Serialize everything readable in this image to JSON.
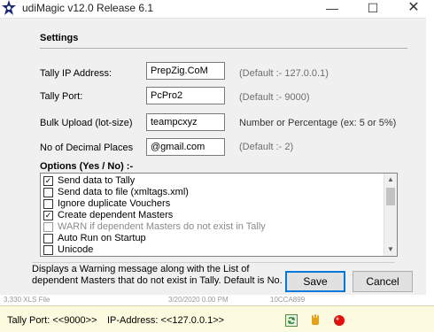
{
  "window": {
    "title": "udiMagic v12.0 Release 6.1",
    "minimize_glyph": "—",
    "maximize_glyph": "☐",
    "close_glyph": "✕"
  },
  "settings": {
    "title": "Settings",
    "fields": [
      {
        "label": "Tally IP Address:",
        "value": "PrepZig.CoM",
        "hint": "(Default :-  127.0.0.1)"
      },
      {
        "label": "Tally Port:",
        "value": "PcPro2",
        "hint": "(Default :-  9000)"
      },
      {
        "label": "Bulk Upload (lot-size)",
        "value": "teampcxyz",
        "hint": "Number or Percentage (ex: 5 or  5%)"
      },
      {
        "label": "No of Decimal Places",
        "value": "@gmail.com",
        "hint": "(Default :-  2)"
      }
    ]
  },
  "options": {
    "title": "Options (Yes / No) :-",
    "items": [
      {
        "label": "Send data to Tally",
        "checked": true,
        "disabled": false
      },
      {
        "label": "Send data to file (xmltags.xml)",
        "checked": false,
        "disabled": false
      },
      {
        "label": "Ignore duplicate Vouchers",
        "checked": false,
        "disabled": false
      },
      {
        "label": "Create dependent Masters",
        "checked": true,
        "disabled": false
      },
      {
        "label": "WARN if dependent Masters do not exist in Tally",
        "checked": false,
        "disabled": true
      },
      {
        "label": "Auto Run on Startup",
        "checked": false,
        "disabled": false
      },
      {
        "label": "Unicode",
        "checked": false,
        "disabled": false
      }
    ]
  },
  "description": "Displays a Warning message along with the List of dependent Masters that do not exist in Tally. Default is No.",
  "buttons": {
    "save": "Save",
    "cancel": "Cancel"
  },
  "statusbar": {
    "port": "Tally Port: <<9000>>",
    "ip": "IP-Address: <<127.0.0.1>>"
  },
  "background_peek": {
    "left_text": "3,330  XLS File",
    "mid_text": "3/20/2020  0.00 PM",
    "right_text": "10CCA899"
  },
  "icons": [
    "star-logo-icon",
    "refresh-icon",
    "hand-icon",
    "record-icon"
  ],
  "colors": {
    "status_bg": "#fcfbe0",
    "accent": "#0078d7",
    "record_red": "#e01010"
  }
}
